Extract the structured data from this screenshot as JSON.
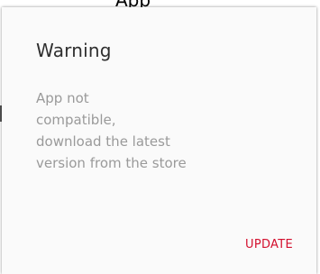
{
  "background": {
    "partial_text": "App"
  },
  "dialog": {
    "title": "Warning",
    "message": "App not\ncompatible,\ndownload the latest\nversion from the store",
    "action_label": "UPDATE"
  },
  "colors": {
    "accent": "#d3102e",
    "title": "#2f2f2f",
    "message": "#9a9a9a",
    "dialog_background": "#fafafa"
  }
}
